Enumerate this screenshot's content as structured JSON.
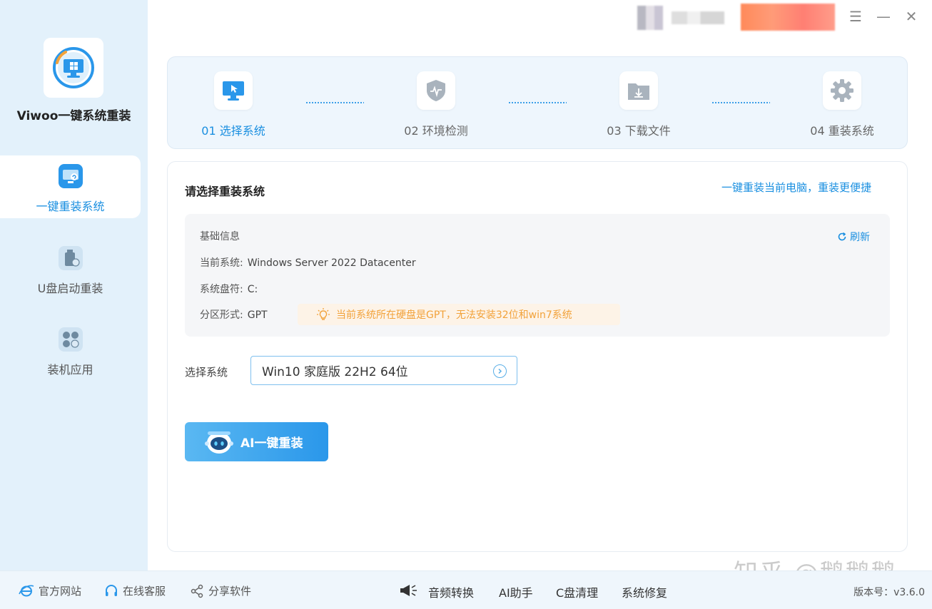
{
  "app": {
    "name": "Viwoo一键系统重装",
    "version": "版本号：v3.6.0",
    "watermark": "知乎 @鹅鹅鹅"
  },
  "sidebar": {
    "items": [
      {
        "label": "一键重装系统",
        "icon": "monitor-reinstall-icon",
        "active": true
      },
      {
        "label": "U盘启动重装",
        "icon": "usb-drive-icon",
        "active": false
      },
      {
        "label": "装机应用",
        "icon": "apps-icon",
        "active": false
      }
    ]
  },
  "window_controls": {
    "menu": "☰",
    "minimize": "—",
    "close": "✕"
  },
  "steps": [
    {
      "label": "01 选择系统",
      "icon": "monitor-cursor-icon",
      "active": true
    },
    {
      "label": "02 环境检测",
      "icon": "shield-pulse-icon",
      "active": false
    },
    {
      "label": "03 下载文件",
      "icon": "folder-download-icon",
      "active": false
    },
    {
      "label": "04 重装系统",
      "icon": "gear-icon",
      "active": false
    }
  ],
  "main": {
    "title": "请选择重装系统",
    "link": "一键重装当前电脑，重装更便捷",
    "info": {
      "heading": "基础信息",
      "refresh": "刷新",
      "rows": [
        {
          "label": "当前系统:",
          "value": "Windows Server 2022 Datacenter"
        },
        {
          "label": "系统盘符:",
          "value": "C:"
        },
        {
          "label": "分区形式:",
          "value": "GPT"
        }
      ],
      "warning": "当前系统所在硬盘是GPT，无法安装32位和win7系统"
    },
    "select_label": "选择系统",
    "select_value": "Win10 家庭版 22H2 64位",
    "ai_button": "AI一键重装"
  },
  "footer": {
    "left": [
      {
        "label": "官方网站",
        "icon": "ie-globe-icon"
      },
      {
        "label": "在线客服",
        "icon": "headset-icon"
      },
      {
        "label": "分享软件",
        "icon": "share-icon"
      }
    ],
    "tools": [
      "音频转换",
      "AI助手",
      "C盘清理",
      "系统修复"
    ],
    "tools_icon": "megaphone-icon"
  },
  "colors": {
    "accent": "#1a8fe0",
    "sidebar_bg": "#e3f1fb",
    "warning": "#f2a23a"
  }
}
